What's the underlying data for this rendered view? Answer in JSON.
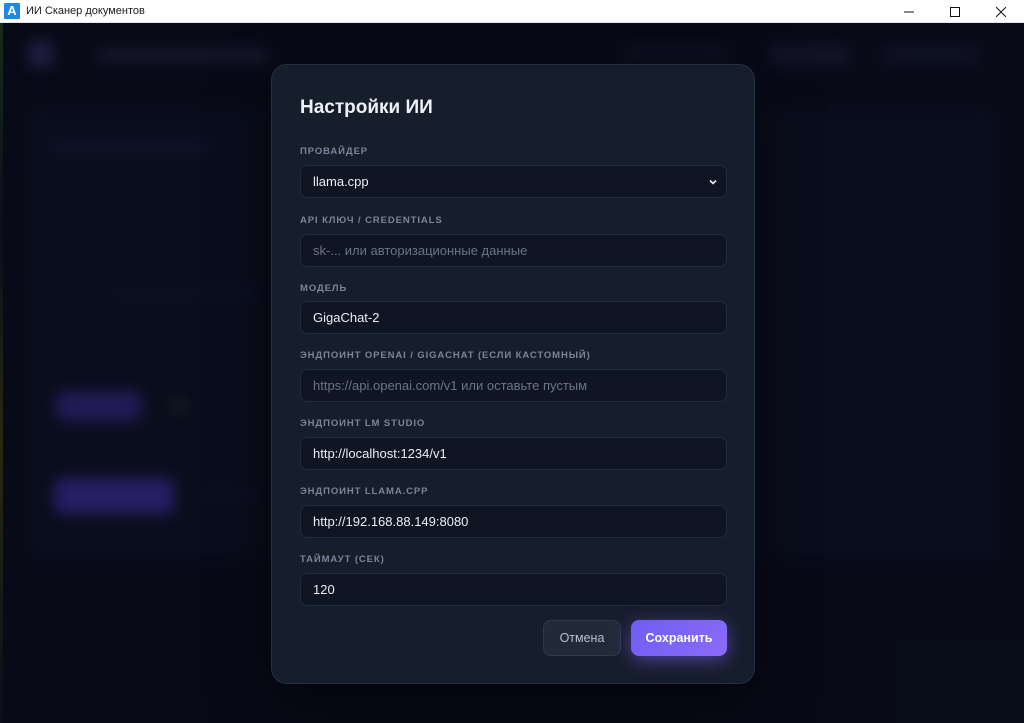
{
  "window": {
    "app_icon_letter": "A",
    "title": "ИИ Сканер документов",
    "controls": [
      "minimize-icon",
      "maximize-icon",
      "close-icon"
    ]
  },
  "modal": {
    "title": "Настройки ИИ",
    "fields": {
      "provider": {
        "label": "ПРОВАЙДЕР",
        "value": "llama.cpp",
        "icon": "chevron-down-icon"
      },
      "api_key": {
        "label": "API КЛЮЧ / CREDENTIALS",
        "value": "",
        "placeholder": "sk-... или авторизационные данные"
      },
      "model": {
        "label": "МОДЕЛЬ",
        "value": "GigaChat-2"
      },
      "openai_endpoint": {
        "label": "ЭНДПОИНТ OPENAI / GIGACHAT (ЕСЛИ КАСТОМНЫЙ)",
        "value": "",
        "placeholder": "https://api.openai.com/v1 или оставьте пустым"
      },
      "lmstudio_endpoint": {
        "label": "ЭНДПОИНТ LM STUDIO",
        "value": "http://localhost:1234/v1"
      },
      "llamacpp_endpoint": {
        "label": "ЭНДПОИНТ LLAMA.CPP",
        "value": "http://192.168.88.149:8080"
      },
      "timeout": {
        "label": "ТАЙМАУТ (СЕК)",
        "value": "120"
      }
    },
    "buttons": {
      "cancel": "Отмена",
      "save": "Сохранить"
    }
  },
  "colors": {
    "accent": "#7c5cf6",
    "modal_bg": "#161d2b",
    "app_bg": "#0a0d1c"
  }
}
